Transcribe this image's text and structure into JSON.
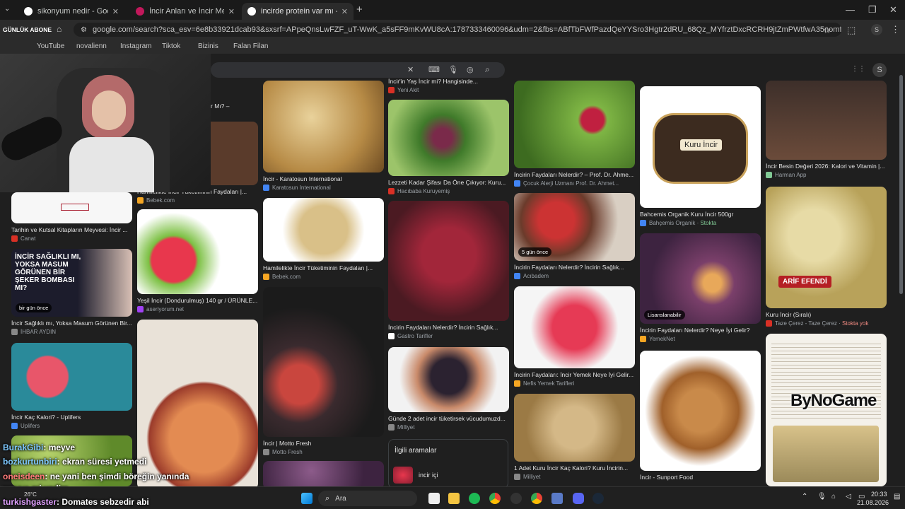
{
  "browser": {
    "tabs": [
      {
        "title": "sikonyum nedir - Google'da Ar"
      },
      {
        "title": "İncir Anları ve İncir Meyvelerin"
      },
      {
        "title": "incirde protein var mı - Google"
      }
    ],
    "new_tab": "+",
    "url": "google.com/search?sca_esv=6e8b33921dcab93&sxsrf=APpeQnsLwFZF_uT-WwK_a5sFF9mKvWU8cA:1787333460096&udm=2&fbs=ABfTbFWfPazdQeYYSro3Hgtr2dRU_68Qz_MYfrztDxcRCRH9jtZmPWtfwA35nomfOhFDkx3lWmnziW6De_Z2ipS8dBhsf...",
    "overlay_tag": "GÜNLÜK ABONE",
    "profile_letter": "S",
    "bookmarks": [
      "YouTube",
      "novalienn",
      "Instagram",
      "Tiktok",
      "Bizinis",
      "Falan Filan"
    ]
  },
  "google": {
    "avatar_letter": "S",
    "search_clear": "✕",
    "apps_icon": "⋮⋮"
  },
  "results": {
    "col1": [
      {
        "caption": "lo Yapar Mı? –",
        "source": ""
      },
      {
        "caption": "Tarihin ve Kutsal Kitapların Meyvesi: İncir ...",
        "source": "Canat"
      },
      {
        "caption": "İncir Sağlıklı mı, Yoksa Masum Görünen Bir...",
        "source": "İHBAR AYDIN",
        "badge": "bir gün önce",
        "overlay": "İNCİR SAĞLIKLI MI, YOKSA MASUM GÖRÜNEN BİR ŞEKER BOMBASI MI?"
      },
      {
        "caption": "İncir Kaç Kalori? - Uplifers",
        "source": "Uplifers"
      }
    ],
    "col2": [
      {
        "caption": "Hamilelikte İncir Tüketiminin Faydaları |...",
        "source": "Bebek.com"
      },
      {
        "caption": "Yeşil İncir (Dondurulmuş) 140 gr / ÜRÜNLE...",
        "source": "aseriyorum.net"
      }
    ],
    "col3": [
      {
        "caption": "İncir - Karatosun International",
        "source": "Karatosun International"
      },
      {
        "caption": "Hamilelikte İncir Tüketiminin Faydaları |...",
        "source": "Bebek.com"
      },
      {
        "caption": "İncir | Motto Fresh",
        "source": "Motto Fresh"
      }
    ],
    "col4": [
      {
        "caption": "İncir'in Yaş İncir mi? Hangisinde...",
        "source": "Yeni Akit"
      },
      {
        "caption": "Lezzeti Kadar Şifası Da Öne Çıkıyor: Kuru...",
        "source": "Hacıbaba Kuruyemiş"
      },
      {
        "caption": "İncirin Faydaları Nelerdir? İncirin Sağlık...",
        "source": "Gastro Tarifler"
      },
      {
        "caption": "Günde 2 adet incir tüketirsek vücudumuzd...",
        "source": "Milliyet"
      }
    ],
    "related": {
      "title": "İlgili aramalar",
      "item": "incir içi"
    },
    "col5": [
      {
        "caption": "İncirin Faydaları Nelerdir? – Prof. Dr. Ahme...",
        "source": "Çocuk Alerji Uzmanı Prof. Dr. Ahmet..."
      },
      {
        "caption": "İncirin Faydaları Nelerdir? İncirin Sağlık...",
        "source": "Acıbadem",
        "badge": "5 gün önce"
      },
      {
        "caption": "İncirin Faydaları: İncir Yemek Neye İyi Gelir...",
        "source": "Nefis Yemek Tarifleri"
      },
      {
        "caption": "1 Adet Kuru İncir Kaç Kalori? Kuru İncirin...",
        "source": "Milliyet"
      }
    ],
    "col6": [
      {
        "caption": "Bahcemis Organik Kuru İncir 500gr",
        "source": "Bahçemis Organik",
        "stock": "Stokta",
        "label": "Kuru İncir"
      },
      {
        "caption": "İncirin Faydaları Nelerdir? Neye İyi Gelir?",
        "source": "YemekNet",
        "badge": "Lisanslanabilir"
      },
      {
        "caption": "İncir - Sunport Food",
        "source": "Sunport Food"
      }
    ],
    "col7": [
      {
        "caption": "İncir Besin Değeri 2026: Kalori ve Vitamin |...",
        "source": "Harman App"
      },
      {
        "caption": "Kuru İncir (Sıralı)",
        "source": "Taze Çerez - Taze Çerez",
        "stock": "Stokta yok",
        "label": "ARİF EFENDİ"
      }
    ]
  },
  "stream": {
    "watermark": "ByNoGame",
    "chat": [
      {
        "user": "BurakGibi",
        "msg": ": meyve"
      },
      {
        "user": "bozkurtunbiri",
        "msg": ": ekran süresi yetmedi"
      },
      {
        "user": "oneisdeen",
        "msg": ": ne yani ben şimdi böreğin yanında meyve mi yedim"
      },
      {
        "user": "turkishgaster",
        "msg": ": Domates sebzedir abi"
      }
    ]
  },
  "taskbar": {
    "weather": "26°C",
    "search": "Ara",
    "time": "20:33",
    "date": "21.08.2026"
  },
  "colors": {
    "accent": "#8ab4f8",
    "stock_green": "#81c995",
    "stock_red": "#f28b82"
  }
}
